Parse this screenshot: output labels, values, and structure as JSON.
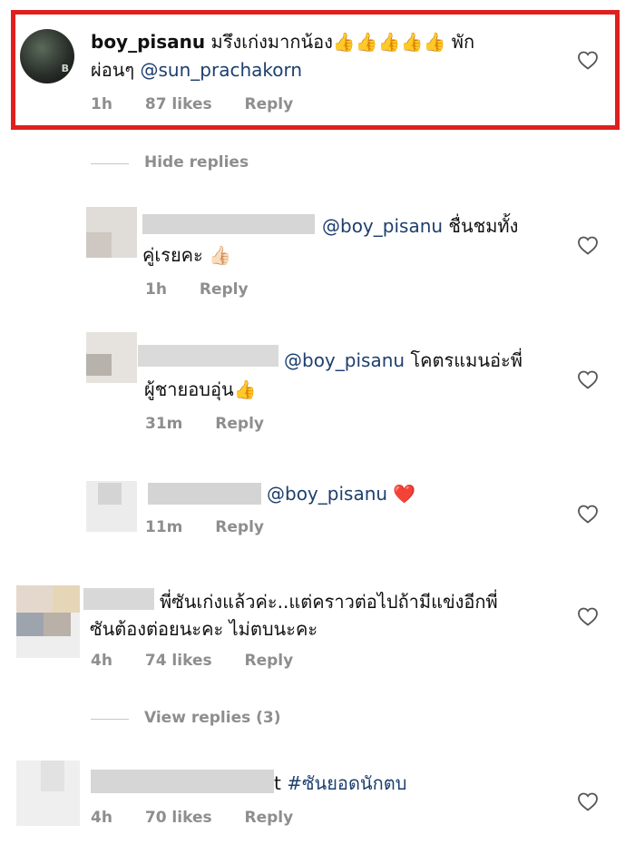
{
  "comments": [
    {
      "username": "boy_pisanu",
      "text_line1": "มรึงเก่งมากน้อง👍👍👍👍👍 พัก",
      "text_line2_prefix": "ผ่อนๆ ",
      "mention": "@sun_prachakorn",
      "time": "1h",
      "likes": "87 likes",
      "reply": "Reply"
    },
    {
      "mention": "@boy_pisanu",
      "text_line1_suffix": " ชื่นชมทั้ง",
      "text_line2": "คู่เรยคะ 👍🏻",
      "time": "1h",
      "reply": "Reply"
    },
    {
      "mention": "@boy_pisanu",
      "text_line1_suffix": " โคตรแมนอ่ะพี่",
      "text_line2": "ผู้ชายอบอุ่น👍",
      "time": "31m",
      "reply": "Reply"
    },
    {
      "mention": "@boy_pisanu",
      "text_line1_suffix": " ❤️",
      "time": "11m",
      "reply": "Reply"
    },
    {
      "text_line1": "พี่ซันเก่งแล้วค่ะ..แต่คราวต่อไปถ้ามีแข่งอีกพี่",
      "text_line2": "ซันต้องต่อยนะคะ ไม่ตบนะคะ",
      "time": "4h",
      "likes": "74 likes",
      "reply": "Reply"
    },
    {
      "text_prefix": "t ",
      "hashtag": "#ซันยอดนักตบ",
      "time": "4h",
      "likes": "70 likes",
      "reply": "Reply"
    }
  ],
  "separators": {
    "hide_replies": "Hide replies",
    "view_replies": "View replies (3)"
  },
  "avatar_tag": "B",
  "icons": {
    "like": "heart-outline-icon"
  },
  "colors": {
    "highlight": "#e0201e",
    "mention": "#1d3f6e",
    "meta": "#8e8e8e"
  }
}
